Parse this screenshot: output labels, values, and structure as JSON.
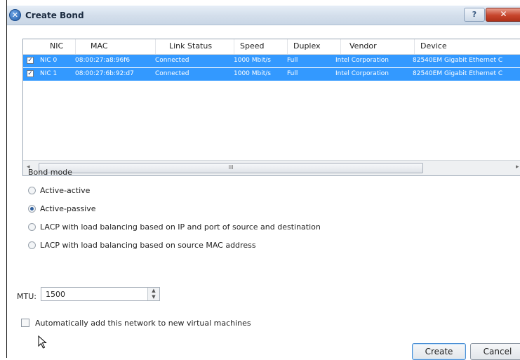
{
  "window": {
    "title": "Create Bond",
    "help_label": "?",
    "close_label": "✕"
  },
  "nic_table": {
    "columns": [
      "NIC",
      "MAC",
      "Link Status",
      "Speed",
      "Duplex",
      "Vendor",
      "Device"
    ],
    "rows": [
      {
        "checked": true,
        "nic": "NIC 0",
        "mac": "08:00:27:a8:96f6",
        "link_status": "Connected",
        "speed": "1000 Mbit/s",
        "duplex": "Full",
        "vendor": "Intel Corporation",
        "device": "82540EM Gigabit Ethernet C"
      },
      {
        "checked": true,
        "nic": "NIC 1",
        "mac": "08:00:27:6b:92:d7",
        "link_status": "Connected",
        "speed": "1000 Mbit/s",
        "duplex": "Full",
        "vendor": "Intel Corporation",
        "device": "82540EM Gigabit Ethernet C"
      }
    ],
    "scroll": {
      "left_arrow": "◂",
      "right_arrow": "▸",
      "grip": "III"
    }
  },
  "bond_mode": {
    "title": "Bond mode",
    "options": [
      {
        "label": "Active-active",
        "selected": false
      },
      {
        "label": "Active-passive",
        "selected": true
      },
      {
        "label": "LACP with load balancing based on IP and port of source and destination",
        "selected": false
      },
      {
        "label": "LACP with load balancing based on source MAC address",
        "selected": false
      }
    ]
  },
  "mtu": {
    "label": "MTU:",
    "value": "1500"
  },
  "auto_add": {
    "label": "Automatically add this network to new virtual machines",
    "checked": false
  },
  "buttons": {
    "create": "Create",
    "cancel": "Cancel"
  },
  "colors": {
    "selection": "#3399ff",
    "title_bar": "#d3deeb",
    "close_button": "#c7452c"
  }
}
